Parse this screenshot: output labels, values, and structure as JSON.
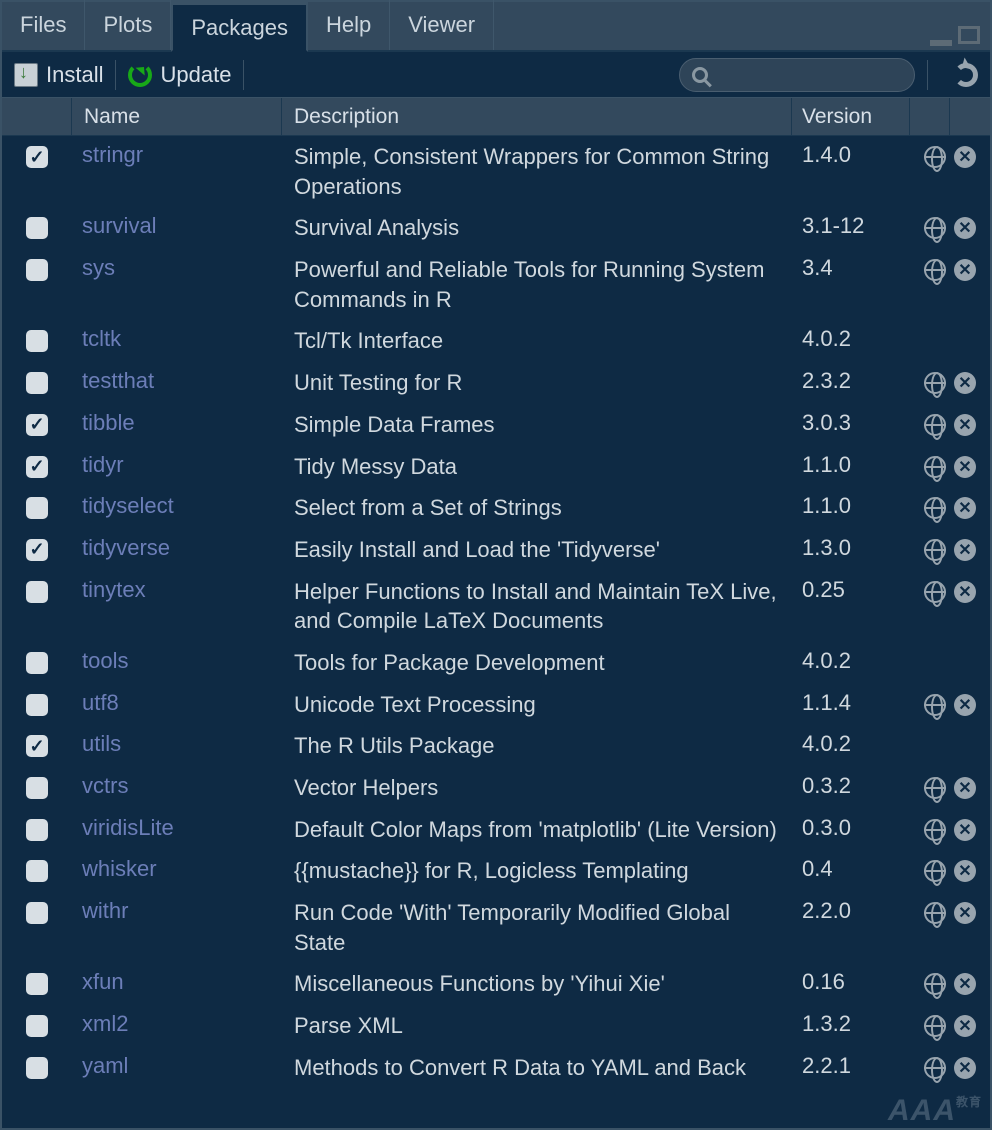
{
  "tabs": [
    "Files",
    "Plots",
    "Packages",
    "Help",
    "Viewer"
  ],
  "active_tab": 2,
  "toolbar": {
    "install_label": "Install",
    "update_label": "Update"
  },
  "headers": {
    "name": "Name",
    "description": "Description",
    "version": "Version"
  },
  "packages": [
    {
      "checked": true,
      "name": "stringr",
      "desc": "Simple, Consistent Wrappers for Common String Operations",
      "ver": "1.4.0",
      "web": true
    },
    {
      "checked": false,
      "name": "survival",
      "desc": "Survival Analysis",
      "ver": "3.1-12",
      "web": true
    },
    {
      "checked": false,
      "name": "sys",
      "desc": "Powerful and Reliable Tools for Running System Commands in R",
      "ver": "3.4",
      "web": true
    },
    {
      "checked": false,
      "name": "tcltk",
      "desc": "Tcl/Tk Interface",
      "ver": "4.0.2",
      "web": false
    },
    {
      "checked": false,
      "name": "testthat",
      "desc": "Unit Testing for R",
      "ver": "2.3.2",
      "web": true
    },
    {
      "checked": true,
      "name": "tibble",
      "desc": "Simple Data Frames",
      "ver": "3.0.3",
      "web": true
    },
    {
      "checked": true,
      "name": "tidyr",
      "desc": "Tidy Messy Data",
      "ver": "1.1.0",
      "web": true
    },
    {
      "checked": false,
      "name": "tidyselect",
      "desc": "Select from a Set of Strings",
      "ver": "1.1.0",
      "web": true
    },
    {
      "checked": true,
      "name": "tidyverse",
      "desc": "Easily Install and Load the 'Tidyverse'",
      "ver": "1.3.0",
      "web": true
    },
    {
      "checked": false,
      "name": "tinytex",
      "desc": "Helper Functions to Install and Maintain TeX Live, and Compile LaTeX Documents",
      "ver": "0.25",
      "web": true
    },
    {
      "checked": false,
      "name": "tools",
      "desc": "Tools for Package Development",
      "ver": "4.0.2",
      "web": false
    },
    {
      "checked": false,
      "name": "utf8",
      "desc": "Unicode Text Processing",
      "ver": "1.1.4",
      "web": true
    },
    {
      "checked": true,
      "name": "utils",
      "desc": "The R Utils Package",
      "ver": "4.0.2",
      "web": false
    },
    {
      "checked": false,
      "name": "vctrs",
      "desc": "Vector Helpers",
      "ver": "0.3.2",
      "web": true
    },
    {
      "checked": false,
      "name": "viridisLite",
      "desc": "Default Color Maps from 'matplotlib' (Lite Version)",
      "ver": "0.3.0",
      "web": true
    },
    {
      "checked": false,
      "name": "whisker",
      "desc": "{{mustache}} for R, Logicless Templating",
      "ver": "0.4",
      "web": true
    },
    {
      "checked": false,
      "name": "withr",
      "desc": "Run Code 'With' Temporarily Modified Global State",
      "ver": "2.2.0",
      "web": true
    },
    {
      "checked": false,
      "name": "xfun",
      "desc": "Miscellaneous Functions by 'Yihui Xie'",
      "ver": "0.16",
      "web": true
    },
    {
      "checked": false,
      "name": "xml2",
      "desc": "Parse XML",
      "ver": "1.3.2",
      "web": true
    },
    {
      "checked": false,
      "name": "yaml",
      "desc": "Methods to Convert R Data to YAML and Back",
      "ver": "2.2.1",
      "web": true
    }
  ],
  "watermark": "AAA",
  "watermark_sub": "教育"
}
